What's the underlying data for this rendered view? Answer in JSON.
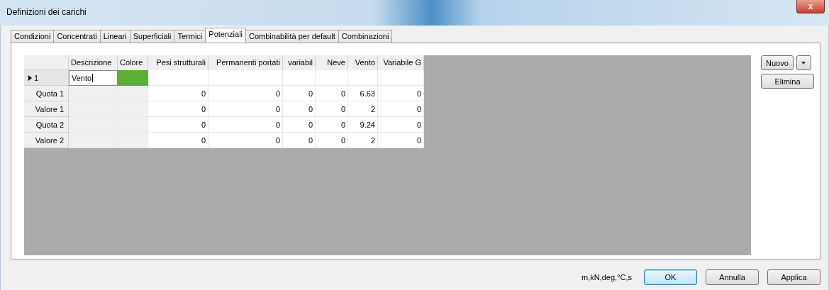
{
  "window": {
    "title": "Definizioni dei carichi",
    "close": "x"
  },
  "tabs": [
    {
      "label": "Condizioni",
      "selected": false
    },
    {
      "label": "Concentrati",
      "selected": false
    },
    {
      "label": "Lineari",
      "selected": false
    },
    {
      "label": "Superficiali",
      "selected": false
    },
    {
      "label": "Termici",
      "selected": false
    },
    {
      "label": "Potenziali",
      "selected": true
    },
    {
      "label": "Combinabilità per default",
      "selected": false
    },
    {
      "label": "Combinazioni",
      "selected": false
    }
  ],
  "grid": {
    "columns": [
      "Descrizione",
      "Colore",
      "Pesi strutturali",
      "Permanenti portati",
      "variabil",
      "Neve",
      "Vento",
      "Variabile G"
    ],
    "rows": [
      {
        "header": "1",
        "current": true,
        "descrizione": "Vento",
        "color": "#5bb033",
        "values": []
      },
      {
        "header": "Quota 1",
        "current": false,
        "values": [
          "0",
          "0",
          "0",
          "0",
          "6.63",
          "0"
        ]
      },
      {
        "header": "Valore 1",
        "current": false,
        "values": [
          "0",
          "0",
          "0",
          "0",
          "2",
          "0"
        ]
      },
      {
        "header": "Quota 2",
        "current": false,
        "values": [
          "0",
          "0",
          "0",
          "0",
          "9.24",
          "0"
        ]
      },
      {
        "header": "Valore 2",
        "current": false,
        "values": [
          "0",
          "0",
          "0",
          "0",
          "2",
          "0"
        ]
      }
    ]
  },
  "side_buttons": {
    "new": "Nuovo",
    "delete": "Elimina"
  },
  "units": "m,kN,deg,°C,s",
  "buttons": [
    {
      "label": "OK",
      "default": true
    },
    {
      "label": "Annulla",
      "default": false
    },
    {
      "label": "Applica",
      "default": false
    }
  ]
}
